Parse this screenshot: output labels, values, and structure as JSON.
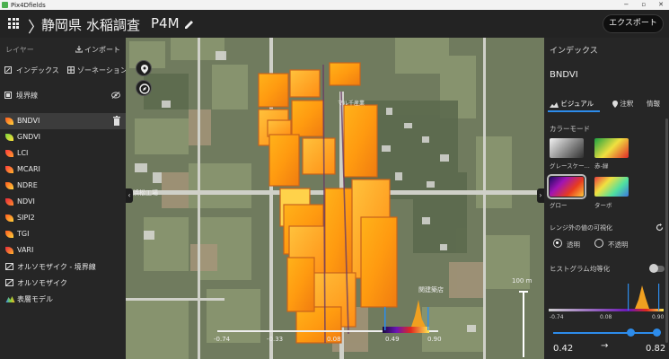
{
  "titlebar": {
    "title": "Pix4Dfields",
    "min": "−",
    "max": "▫",
    "close": "✕"
  },
  "header": {
    "crumbs": [
      "静岡県",
      "水稲調査",
      "P4M"
    ],
    "export_label": "エクスポート"
  },
  "sidebar": {
    "layers_label": "レイヤー",
    "import_label": "インポート",
    "index_label": "インデックス",
    "zoning_label": "ゾーネーション",
    "boundary_label": "境界線",
    "items": [
      {
        "label": "BNDVI",
        "selected": true,
        "icon": "bndvi-leaf-icon"
      },
      {
        "label": "GNDVI"
      },
      {
        "label": "LCI"
      },
      {
        "label": "MCARI"
      },
      {
        "label": "NDRE"
      },
      {
        "label": "NDVI"
      },
      {
        "label": "SIPI2"
      },
      {
        "label": "TGI"
      },
      {
        "label": "VARI"
      },
      {
        "label": "オルソモザイク - 境界線"
      },
      {
        "label": "オルソモザイク"
      },
      {
        "label": "表層モデル"
      }
    ]
  },
  "map": {
    "scale_label": "100 m",
    "place_label_1": "浜松工場",
    "place_label_2": "関建築店",
    "place_label_3": "マル千産業",
    "legend": {
      "min": "-0.74",
      "t1": "-0.33",
      "t2": "0.08",
      "low": "0.49",
      "high": "0.90"
    }
  },
  "right_panel": {
    "title": "インデックス",
    "index_name": "BNDVI",
    "tabs": [
      "ビジュアル",
      "注釈",
      "情報"
    ],
    "color_mode_label": "カラーモード",
    "color_modes": [
      {
        "label": "グレースケー...",
        "selected": false
      },
      {
        "label": "赤-緑",
        "selected": false
      },
      {
        "label": "グロー",
        "selected": true
      },
      {
        "label": "ターボ",
        "selected": false
      }
    ],
    "out_of_range_label": "レンジ外の値の可視化",
    "opt_transparent": "透明",
    "opt_opaque": "不透明",
    "hist_eq_label": "ヒストグラム均等化",
    "hist_min": "-0.74",
    "hist_mid": "0.08",
    "hist_max": "0.90",
    "range_low": "0.42",
    "range_arrow": "→",
    "range_high": "0.82"
  },
  "colors": {
    "accent": "#2d8ceb",
    "panel": "#262626",
    "header": "#232323"
  }
}
